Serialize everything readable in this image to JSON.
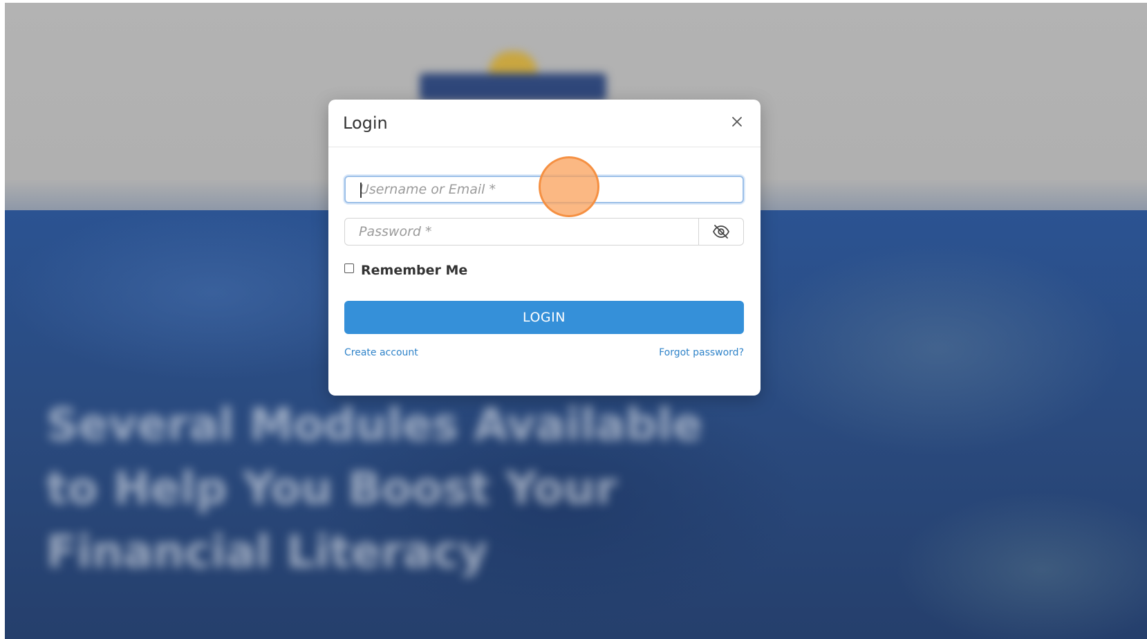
{
  "background": {
    "headline_lines": [
      "Several Modules Available",
      "to Help You Boost Your",
      "Financial Literacy"
    ]
  },
  "modal": {
    "title": "Login",
    "close_icon": "close-icon",
    "username": {
      "placeholder": "Username or Email *",
      "value": ""
    },
    "password": {
      "placeholder": "Password *",
      "value": "",
      "toggle_icon": "eye-slash-icon"
    },
    "remember_me": {
      "label": "Remember Me",
      "checked": false
    },
    "login_button": "LOGIN",
    "create_account": "Create account",
    "forgot_password": "Forgot password?"
  },
  "colors": {
    "primary": "#3590d9",
    "link": "#2f83c9",
    "click_indicator": "#f7a060"
  }
}
